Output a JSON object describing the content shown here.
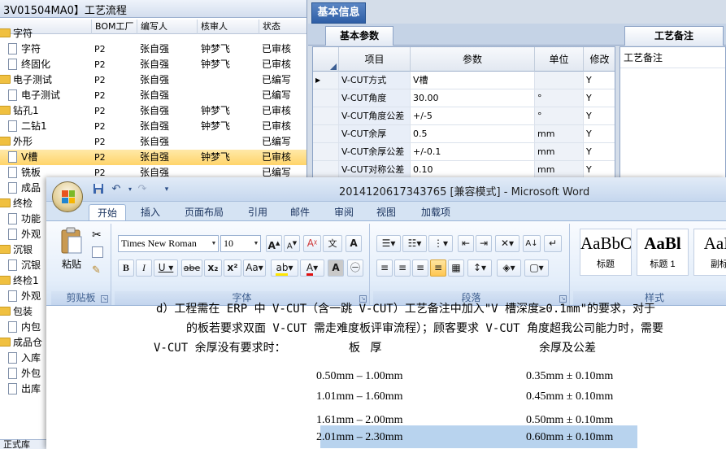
{
  "left": {
    "title": "3V01504MA0】工艺流程",
    "columns": [
      "",
      "BOM工厂",
      "编写人",
      "核审人",
      "状态"
    ],
    "rows": [
      {
        "type": "folder",
        "indent": 0,
        "name": "字符",
        "bom": "",
        "writer": "",
        "reviewer": "",
        "status": ""
      },
      {
        "type": "doc",
        "indent": 1,
        "name": "字符",
        "bom": "P2",
        "writer": "张自强",
        "reviewer": "钟梦飞",
        "status": "已审核"
      },
      {
        "type": "doc",
        "indent": 1,
        "name": "终固化",
        "bom": "P2",
        "writer": "张自强",
        "reviewer": "钟梦飞",
        "status": "已审核"
      },
      {
        "type": "folder",
        "indent": 0,
        "name": "电子测试",
        "bom": "P2",
        "writer": "张自强",
        "reviewer": "",
        "status": "已编写"
      },
      {
        "type": "doc",
        "indent": 1,
        "name": "电子测试",
        "bom": "P2",
        "writer": "张自强",
        "reviewer": "",
        "status": "已编写"
      },
      {
        "type": "folder",
        "indent": 0,
        "name": "钻孔1",
        "bom": "P2",
        "writer": "张自强",
        "reviewer": "钟梦飞",
        "status": "已审核"
      },
      {
        "type": "doc",
        "indent": 1,
        "name": "二钻1",
        "bom": "P2",
        "writer": "张自强",
        "reviewer": "钟梦飞",
        "status": "已审核"
      },
      {
        "type": "folder",
        "indent": 0,
        "name": "外形",
        "bom": "P2",
        "writer": "张自强",
        "reviewer": "",
        "status": "已编写"
      },
      {
        "type": "doc",
        "indent": 1,
        "name": "V槽",
        "bom": "P2",
        "writer": "张自强",
        "reviewer": "钟梦飞",
        "status": "已审核",
        "selected": true
      },
      {
        "type": "doc",
        "indent": 1,
        "name": "铣板",
        "bom": "P2",
        "writer": "张自强",
        "reviewer": "",
        "status": "已编写"
      },
      {
        "type": "doc",
        "indent": 1,
        "name": "成品",
        "bom": "",
        "writer": "",
        "reviewer": "",
        "status": ""
      },
      {
        "type": "folder",
        "indent": 0,
        "name": "终检",
        "bom": "",
        "writer": "",
        "reviewer": "",
        "status": ""
      },
      {
        "type": "doc",
        "indent": 1,
        "name": "功能",
        "bom": "",
        "writer": "",
        "reviewer": "",
        "status": ""
      },
      {
        "type": "doc",
        "indent": 1,
        "name": "外观",
        "bom": "",
        "writer": "",
        "reviewer": "",
        "status": ""
      },
      {
        "type": "folder",
        "indent": 0,
        "name": "沉银",
        "bom": "",
        "writer": "",
        "reviewer": "",
        "status": ""
      },
      {
        "type": "doc",
        "indent": 1,
        "name": "沉银",
        "bom": "",
        "writer": "",
        "reviewer": "",
        "status": ""
      },
      {
        "type": "folder",
        "indent": 0,
        "name": "终检1",
        "bom": "",
        "writer": "",
        "reviewer": "",
        "status": ""
      },
      {
        "type": "doc",
        "indent": 1,
        "name": "外观",
        "bom": "",
        "writer": "",
        "reviewer": "",
        "status": ""
      },
      {
        "type": "folder",
        "indent": 0,
        "name": "包装",
        "bom": "",
        "writer": "",
        "reviewer": "",
        "status": ""
      },
      {
        "type": "doc",
        "indent": 1,
        "name": "内包",
        "bom": "",
        "writer": "",
        "reviewer": "",
        "status": ""
      },
      {
        "type": "folder",
        "indent": 0,
        "name": "成品仓",
        "bom": "",
        "writer": "",
        "reviewer": "",
        "status": ""
      },
      {
        "type": "doc",
        "indent": 1,
        "name": "入库",
        "bom": "",
        "writer": "",
        "reviewer": "",
        "status": ""
      },
      {
        "type": "doc",
        "indent": 1,
        "name": "外包",
        "bom": "",
        "writer": "",
        "reviewer": "",
        "status": ""
      },
      {
        "type": "doc",
        "indent": 1,
        "name": "出库",
        "bom": "",
        "writer": "",
        "reviewer": "",
        "status": ""
      }
    ],
    "footer": "正式库"
  },
  "right": {
    "main_tab": "基本信息",
    "sub_tab_params": "基本参数",
    "sub_tab_notes": "工艺备注",
    "notes_label": "工艺备注",
    "grid_columns": [
      "项目",
      "参数",
      "单位",
      "修改"
    ],
    "grid_rows": [
      {
        "item": "V-CUT方式",
        "value": "V槽",
        "unit": "",
        "edit": "Y",
        "current": true
      },
      {
        "item": "V-CUT角度",
        "value": "30.00",
        "unit": "°",
        "edit": "Y"
      },
      {
        "item": "V-CUT角度公差",
        "value": "+/-5",
        "unit": "°",
        "edit": "Y"
      },
      {
        "item": "V-CUT余厚",
        "value": "0.5",
        "unit": "mm",
        "edit": "Y"
      },
      {
        "item": "V-CUT余厚公差",
        "value": "+/-0.1",
        "unit": "mm",
        "edit": "Y"
      },
      {
        "item": "V-CUT对称公差",
        "value": "0.10",
        "unit": "mm",
        "edit": "Y"
      }
    ]
  },
  "word": {
    "title": "2014120617343765 [兼容模式] - Microsoft Word",
    "tabs": [
      "开始",
      "插入",
      "页面布局",
      "引用",
      "邮件",
      "审阅",
      "视图",
      "加载项"
    ],
    "font_name": "Times New Roman",
    "font_size": "10",
    "groups": {
      "clipboard": "剪贴板",
      "font": "字体",
      "paragraph": "段落",
      "styles": "样式"
    },
    "paste_label": "粘贴",
    "styles": [
      {
        "sample": "AaBbC",
        "name": "标题"
      },
      {
        "sample": "AaBl",
        "name": "标题 1"
      },
      {
        "sample": "AaB",
        "name": "副标"
      }
    ],
    "doc": {
      "line1": "d）工程需在 ERP 中 V-CUT（含一跳 V-CUT）工艺备注中加入\"V 槽深度≥0.1mm\"的要求，对于",
      "line2": "的板若要求双面 V-CUT 需走难度板评审流程）；顾客要求 V-CUT 角度超我公司能力时，需要",
      "line3_left": "V-CUT 余厚没有要求时：",
      "col1_head": "板 厚",
      "col2_head": "余厚及公差",
      "table": [
        {
          "thickness": "0.50mm – 1.00mm",
          "remaining": "0.35mm ± 0.10mm"
        },
        {
          "thickness": "1.01mm – 1.60mm",
          "remaining": "0.45mm ± 0.10mm"
        },
        {
          "thickness": "1.61mm – 2.00mm",
          "remaining": "0.50mm ± 0.10mm"
        },
        {
          "thickness": "2.01mm – 2.30mm",
          "remaining": "0.60mm ± 0.10mm"
        }
      ]
    }
  }
}
